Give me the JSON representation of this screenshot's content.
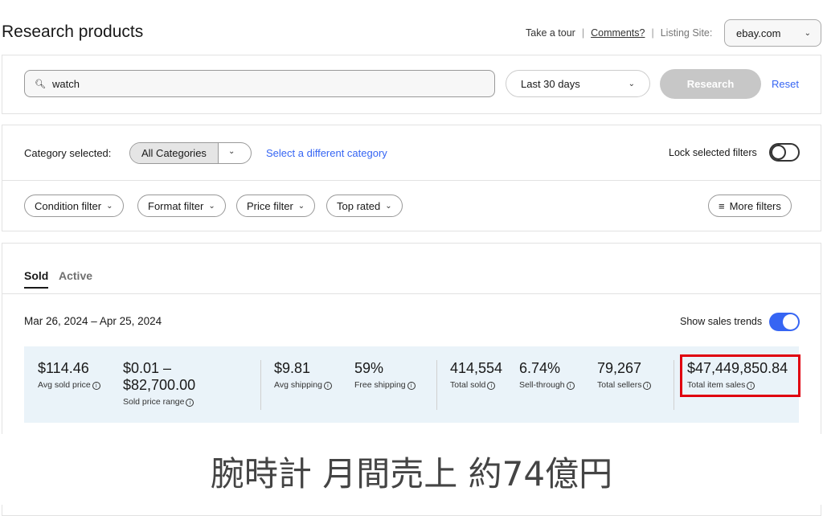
{
  "header": {
    "title": "Research products",
    "tour": "Take a tour",
    "comments": "Comments?",
    "listing_site_label": "Listing Site:",
    "listing_site": "ebay.com"
  },
  "search": {
    "value": "watch",
    "date_range": "Last 30 days",
    "research": "Research",
    "reset": "Reset"
  },
  "category": {
    "label": "Category selected:",
    "value": "All Categories",
    "change": "Select a different category",
    "lock": "Lock selected filters"
  },
  "filters": [
    "Condition filter",
    "Format filter",
    "Price filter",
    "Top rated"
  ],
  "more_filters": "More filters",
  "tabs": [
    "Sold",
    "Active"
  ],
  "results": {
    "date_range": "Mar 26, 2024 – Apr 25, 2024",
    "trends": "Show sales trends",
    "stats": [
      {
        "value": "$114.46",
        "label": "Avg sold price"
      },
      {
        "value": "$0.01 –",
        "value2": "$82,700.00",
        "label": "Sold price range"
      },
      {
        "value": "$9.81",
        "label": "Avg shipping"
      },
      {
        "value": "59%",
        "label": "Free shipping"
      },
      {
        "value": "414,554",
        "label": "Total sold"
      },
      {
        "value": "6.74%",
        "label": "Sell-through"
      },
      {
        "value": "79,267",
        "label": "Total sellers"
      },
      {
        "value": "$47,449,850.84",
        "label": "Total item sales"
      }
    ]
  },
  "caption": "腕時計 月間売上 約74億円",
  "colors": {
    "link": "#3665f3",
    "highlight": "#e0000f",
    "stats_bg": "#eaf3f9"
  }
}
